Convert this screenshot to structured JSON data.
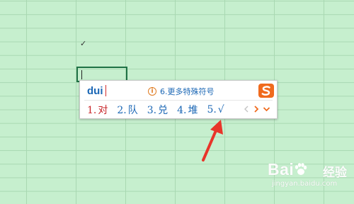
{
  "sheet": {
    "checkmark": "✓"
  },
  "ime": {
    "input_text": "dui",
    "hint": "6.更多特殊符号",
    "hint_icon": "info-icon",
    "logo_icon": "sogou-s-icon",
    "candidates": [
      {
        "num": "1.",
        "text": "对"
      },
      {
        "num": "2.",
        "text": "队"
      },
      {
        "num": "3.",
        "text": "兑"
      },
      {
        "num": "4.",
        "text": "堆"
      },
      {
        "num": "5.",
        "text": "√"
      }
    ],
    "pager": {
      "prev_icon": "chevron-left-icon",
      "next_icon": "chevron-right-icon",
      "expand_icon": "chevron-down-icon"
    }
  },
  "annotation": {
    "arrow_color": "#e8352a"
  },
  "watermark": {
    "brand_prefix": "Bai",
    "brand_suffix": "经验",
    "url": "jingyan.baidu.com"
  },
  "colors": {
    "sheet_bg": "#c6efce",
    "gridline": "#a9d8b2",
    "cell_border": "#1f7245",
    "ime_accent": "#1b67b5",
    "first_candidate": "#c8262a",
    "logo": "#f06a1d"
  }
}
